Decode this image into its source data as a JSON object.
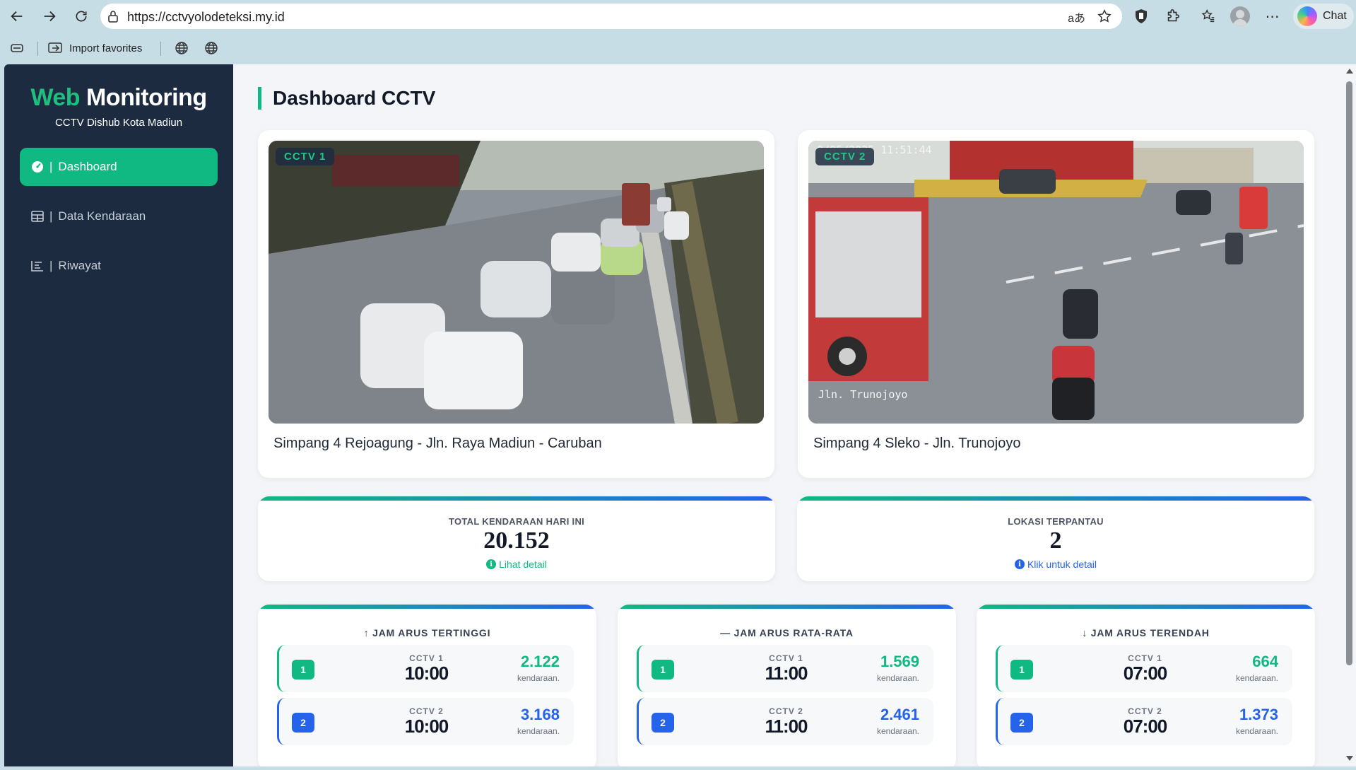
{
  "browser": {
    "url": "https://cctvyolodeteksi.my.id",
    "chat_label": "Chat",
    "bookmarks": {
      "import_label": "Import favorites"
    }
  },
  "sidebar": {
    "brand_accent": "Web",
    "brand_rest": "Monitoring",
    "subtitle": "CCTV Dishub Kota Madiun",
    "items": [
      {
        "label": "Dashboard",
        "icon": "gauge-icon",
        "active": true
      },
      {
        "label": "Data Kendaraan",
        "icon": "table-icon",
        "active": false
      },
      {
        "label": "Riwayat",
        "icon": "chart-icon",
        "active": false
      }
    ]
  },
  "page": {
    "title": "Dashboard CCTV"
  },
  "cameras": [
    {
      "badge": "CCTV 1",
      "location": "Simpang 4 Rejoagung - Jln. Raya Madiun - Caruban",
      "overlay_time": "",
      "overlay_street": ""
    },
    {
      "badge": "CCTV 2",
      "location": "Simpang 4 Sleko - Jln. Trunojoyo",
      "overlay_time": "0/05/2025 11:51:44",
      "overlay_street": "Jln. Trunojoyo"
    }
  ],
  "stats": {
    "total": {
      "label": "TOTAL KENDARAAN HARI INI",
      "value": "20.152",
      "link": "Lihat detail"
    },
    "locations": {
      "label": "LOKASI TERPANTAU",
      "value": "2",
      "link": "Klik untuk detail"
    }
  },
  "peaks": [
    {
      "title": "↑ JAM ARUS TERTINGGI",
      "rows": [
        {
          "num": "1",
          "cam": "CCTV 1",
          "time": "10:00",
          "count": "2.122",
          "unit": "kendaraan."
        },
        {
          "num": "2",
          "cam": "CCTV 2",
          "time": "10:00",
          "count": "3.168",
          "unit": "kendaraan."
        }
      ]
    },
    {
      "title": "— JAM ARUS RATA-RATA",
      "rows": [
        {
          "num": "1",
          "cam": "CCTV 1",
          "time": "11:00",
          "count": "1.569",
          "unit": "kendaraan."
        },
        {
          "num": "2",
          "cam": "CCTV 2",
          "time": "11:00",
          "count": "2.461",
          "unit": "kendaraan."
        }
      ]
    },
    {
      "title": "↓ JAM ARUS TERENDAH",
      "rows": [
        {
          "num": "1",
          "cam": "CCTV 1",
          "time": "07:00",
          "count": "664",
          "unit": "kendaraan."
        },
        {
          "num": "2",
          "cam": "CCTV 2",
          "time": "07:00",
          "count": "1.373",
          "unit": "kendaraan."
        }
      ]
    }
  ],
  "colors": {
    "accent_green": "#10b981",
    "accent_blue": "#2563eb",
    "sidebar_bg": "#1c2b40",
    "browser_bg": "#c7dde6"
  }
}
